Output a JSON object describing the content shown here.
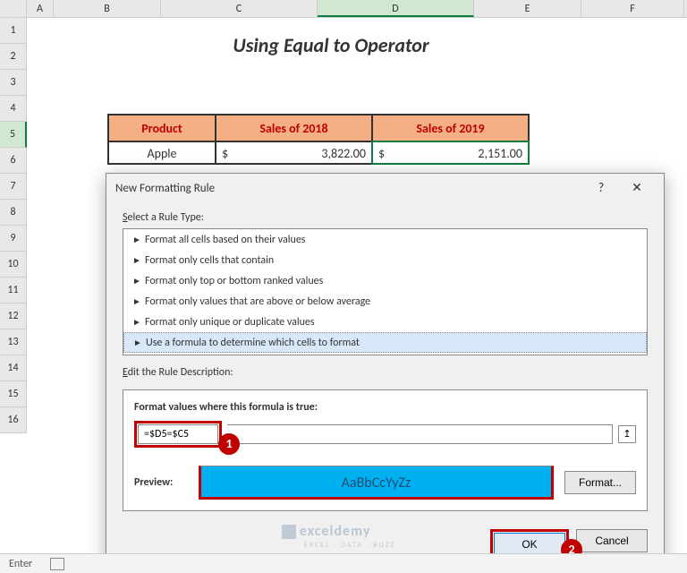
{
  "columns": [
    "A",
    "B",
    "C",
    "D",
    "E",
    "F"
  ],
  "rows": [
    "1",
    "2",
    "3",
    "4",
    "5",
    "6",
    "7",
    "8",
    "9",
    "10",
    "11",
    "12",
    "13",
    "14",
    "15",
    "16"
  ],
  "selected_col": "D",
  "selected_row": "5",
  "title": "Using Equal to Operator",
  "table": {
    "headers": [
      "Product",
      "Sales of 2018",
      "Sales of 2019"
    ],
    "row1": {
      "product": "Apple",
      "c_sym": "$",
      "c_val": "3,822.00",
      "d_sym": "$",
      "d_val": "2,151.00"
    }
  },
  "dialog": {
    "title": "New Formatting Rule",
    "help": "?",
    "close": "✕",
    "select_label_pre": "S",
    "select_label": "elect a Rule Type:",
    "rules": [
      "Format all cells based on their values",
      "Format only cells that contain",
      "Format only top or bottom ranked values",
      "Format only values that are above or below average",
      "Format only unique or duplicate values",
      "Use a formula to determine which cells to format"
    ],
    "edit_label_pre": "E",
    "edit_label": "dit the Rule Description:",
    "formula_label": "Format values where this formula is true:",
    "formula": "=$D5=$C5",
    "collapse": "↥",
    "preview_label": "Preview:",
    "preview_text": "AaBbCcYyZz",
    "format_btn": "Format...",
    "ok": "OK",
    "cancel": "Cancel"
  },
  "callouts": {
    "c1": "1",
    "c2": "2"
  },
  "statusbar": {
    "mode": "Enter"
  },
  "watermark": {
    "brand": "exceldemy",
    "sub": "EXCEL · DATA · BUZZ"
  },
  "chart_data": {
    "type": "table",
    "title": "Using Equal to Operator",
    "columns": [
      "Product",
      "Sales of 2018",
      "Sales of 2019"
    ],
    "rows": [
      {
        "Product": "Apple",
        "Sales of 2018": 3822.0,
        "Sales of 2019": 2151.0
      }
    ]
  }
}
